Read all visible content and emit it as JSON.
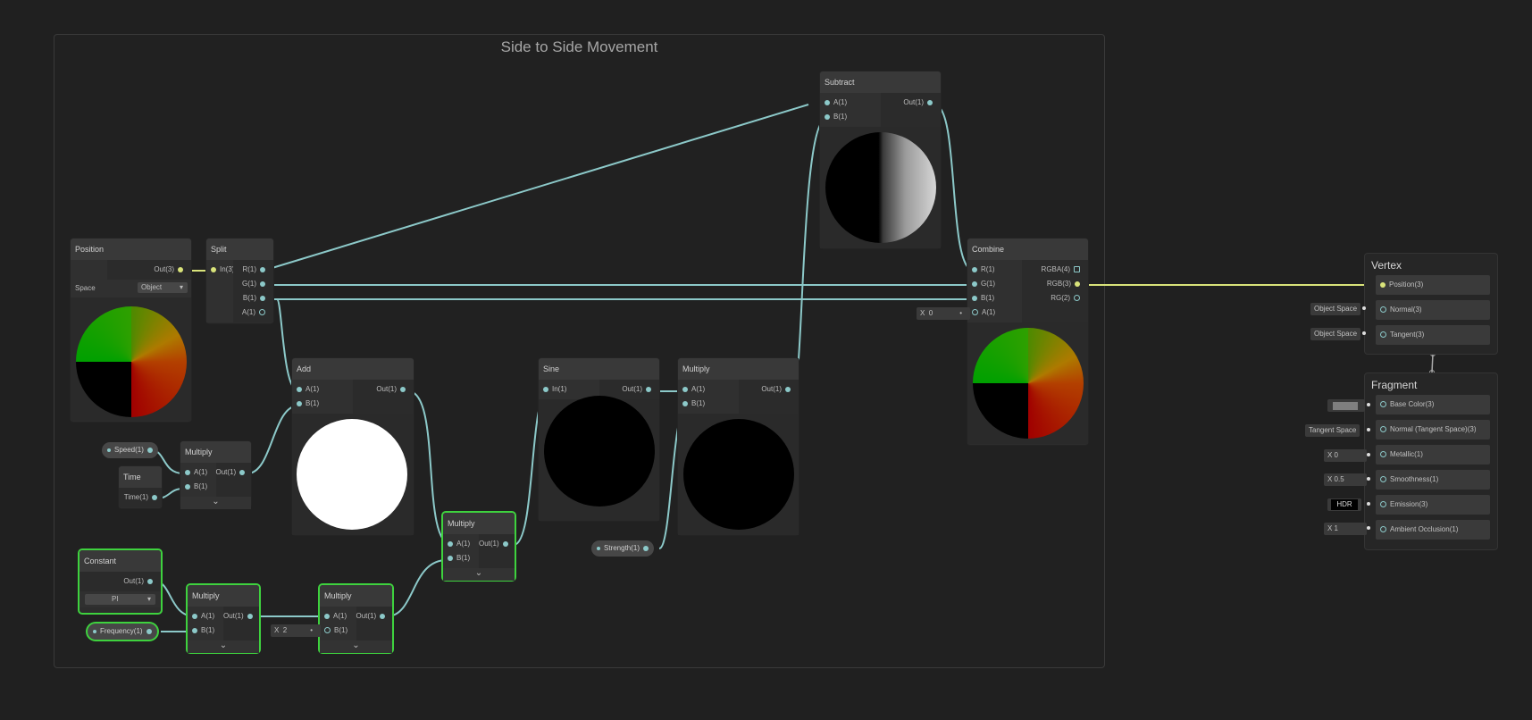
{
  "group": {
    "title": "Side to Side Movement"
  },
  "nodes": {
    "position": {
      "title": "Position",
      "out": "Out(3)",
      "space_label": "Space",
      "space_value": "Object"
    },
    "split": {
      "title": "Split",
      "in": "In(3)",
      "outs": [
        "R(1)",
        "G(1)",
        "B(1)",
        "A(1)"
      ]
    },
    "subtract": {
      "title": "Subtract",
      "ins": [
        "A(1)",
        "B(1)"
      ],
      "out": "Out(1)"
    },
    "combine": {
      "title": "Combine",
      "ins": [
        "R(1)",
        "G(1)",
        "B(1)",
        "A(1)"
      ],
      "outs": [
        "RGBA(4)",
        "RGB(3)",
        "RG(2)"
      ],
      "a_x_label": "X",
      "a_value": "0"
    },
    "add": {
      "title": "Add",
      "ins": [
        "A(1)",
        "B(1)"
      ],
      "out": "Out(1)"
    },
    "sine": {
      "title": "Sine",
      "in": "In(1)",
      "out": "Out(1)"
    },
    "multiply_top": {
      "title": "Multiply",
      "ins": [
        "A(1)",
        "B(1)"
      ],
      "out": "Out(1)"
    },
    "multiply_speed": {
      "title": "Multiply",
      "ins": [
        "A(1)",
        "B(1)"
      ],
      "out": "Out(1)"
    },
    "multiply_mid": {
      "title": "Multiply",
      "ins": [
        "A(1)",
        "B(1)"
      ],
      "out": "Out(1)"
    },
    "multiply_c1": {
      "title": "Multiply",
      "ins": [
        "A(1)",
        "B(1)"
      ],
      "out": "Out(1)"
    },
    "multiply_c2": {
      "title": "Multiply",
      "ins": [
        "A(1)",
        "B(1)"
      ],
      "out": "Out(1)",
      "b_x_label": "X",
      "b_value": "2"
    },
    "time": {
      "title": "Time",
      "out": "Time(1)"
    },
    "constant": {
      "title": "Constant",
      "out": "Out(1)",
      "value": "PI"
    }
  },
  "properties": {
    "speed": "Speed(1)",
    "frequency": "Frequency(1)",
    "strength": "Strength(1)"
  },
  "master": {
    "vertex": {
      "title": "Vertex",
      "blocks": [
        "Position(3)",
        "Normal(3)",
        "Tangent(3)"
      ],
      "inputs": [
        "",
        "Object Space",
        "Object Space"
      ]
    },
    "fragment": {
      "title": "Fragment",
      "blocks": [
        "Base Color(3)",
        "Normal (Tangent Space)(3)",
        "Metallic(1)",
        "Smoothness(1)",
        "Emission(3)",
        "Ambient Occlusion(1)"
      ],
      "inputs": [
        "",
        "Tangent Space",
        "X  0",
        "X  0.5",
        "HDR",
        "X  1"
      ]
    }
  },
  "colors": {
    "wire": "#8cc9c9",
    "wire_vec3": "#d9e37a",
    "selection": "#3ed23e"
  }
}
